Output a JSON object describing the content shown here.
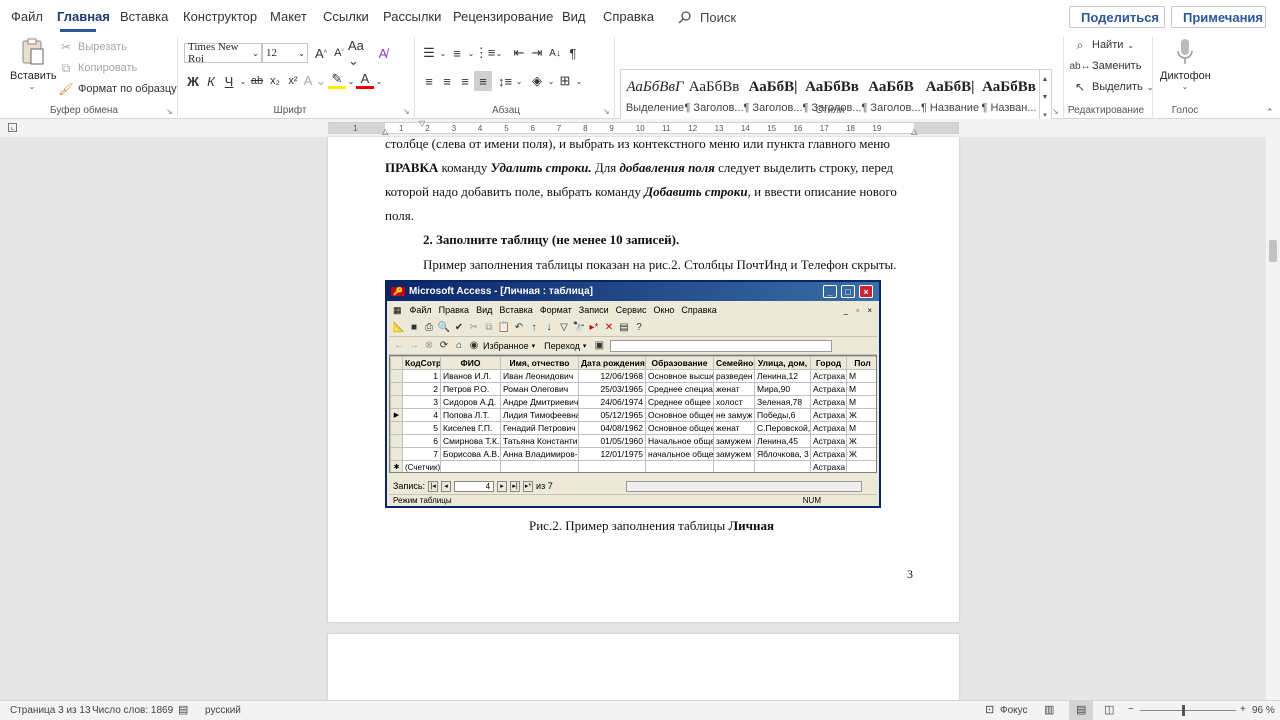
{
  "tabs": [
    "Файл",
    "Главная",
    "Вставка",
    "Конструктор",
    "Макет",
    "Ссылки",
    "Рассылки",
    "Рецензирование",
    "Вид",
    "Справка"
  ],
  "search_label": "Поиск",
  "share_label": "Поделиться",
  "notes_label": "Примечания",
  "clipboard": {
    "paste": "Вставить",
    "cut": "Вырезать",
    "copy": "Копировать",
    "format": "Формат по образцу",
    "group": "Буфер обмена"
  },
  "font": {
    "name": "Times New Roi",
    "size": "12",
    "group": "Шрифт"
  },
  "paragraph_group": "Абзац",
  "styles": {
    "group": "Стили",
    "items": [
      {
        "preview": "АаБбВвГ",
        "name": "Выделение"
      },
      {
        "preview": "АаБбВв",
        "name": "¶ Заголов..."
      },
      {
        "preview": "АаБбВ|",
        "name": "¶ Заголов..."
      },
      {
        "preview": "АаБбВв",
        "name": "¶ Заголов..."
      },
      {
        "preview": "АаБбВ",
        "name": "¶ Заголов..."
      },
      {
        "preview": "АаБбВ|",
        "name": "¶ Название"
      },
      {
        "preview": "АаБбВв",
        "name": "¶ Назван..."
      }
    ]
  },
  "editing": {
    "find": "Найти",
    "replace": "Заменить",
    "select": "Выделить",
    "group": "Редактирование"
  },
  "voice": {
    "dictate": "Диктофон",
    "group": "Голос"
  },
  "ruler_ticks": [
    "1",
    "1",
    "2",
    "3",
    "4",
    "5",
    "6",
    "7",
    "8",
    "9",
    "10",
    "11",
    "12",
    "13",
    "14",
    "15",
    "16",
    "17",
    "18",
    "19"
  ],
  "doc": {
    "line1": "столбце (слева от имени поля), и выбрать из контекстного меню или пункта главного меню",
    "line2a": "ПРАВКА",
    "line2b": " команду ",
    "line2c": "Удалить строки.",
    "line2d": " Для ",
    "line2e": "добавления поля",
    "line2f": " следует выделить строку, перед",
    "line3a": "которой надо добавить поле, выбрать команду ",
    "line3b": "Добавить строки",
    "line3c": ", и ввести описание нового",
    "line4": "поля.",
    "step2": "2. Заполните таблицу (не менее 10 записей).",
    "example": "Пример заполнения таблицы показан на рис.2. Столбцы ПочтИнд и Телефон скрыты.",
    "caption_a": "Рис.2. Пример заполнения таблицы ",
    "caption_b": "Личная",
    "page_num": "3"
  },
  "access": {
    "title": "Microsoft Access - [Личная : таблица]",
    "menu": [
      "Файл",
      "Правка",
      "Вид",
      "Вставка",
      "Формат",
      "Записи",
      "Сервис",
      "Окно",
      "Справка"
    ],
    "izbrannoe": "Избранное",
    "perehod": "Переход",
    "headers": [
      "КодСотр",
      "ФИО",
      "Имя, отчество",
      "Дата рождения",
      "Образование",
      "Семейное",
      "Улица, дом,",
      "Город",
      "Пол"
    ],
    "rows": [
      [
        "1",
        "Иванов И.Л.",
        "Иван Леонидович",
        "12/06/1968",
        "Основное высше",
        "разведен",
        "Ленина,12",
        "Астраха",
        "М"
      ],
      [
        "2",
        "Петров Р.О.",
        "Роман Олегович",
        "25/03/1965",
        "Среднее специал",
        "женат",
        "Мира,90",
        "Астраха",
        "М"
      ],
      [
        "3",
        "Сидоров А.Д.",
        "Андре Дмитриевич",
        "24/06/1974",
        "Среднее общее",
        "холост",
        "Зеленая,78",
        "Астраха",
        "М"
      ],
      [
        "4",
        "Попова Л.Т.",
        "Лидия Тимофеевна",
        "05/12/1965",
        "Основное общее",
        "не замуж",
        "Победы,6",
        "Астраха",
        "Ж"
      ],
      [
        "5",
        "Киселев Г.П.",
        "Генадий Петрович",
        "04/08/1962",
        "Основное общее",
        "женат",
        "С.Перовской,",
        "Астраха",
        "М"
      ],
      [
        "6",
        "Смирнова Т.К.",
        "Татьяна Константин",
        "01/05/1960",
        "Начальное обще",
        "замужем",
        "Ленина,45",
        "Астраха",
        "Ж"
      ],
      [
        "7",
        "Борисова А.В.",
        "Анна Владимиров-",
        "12/01/1975",
        "начальное обще",
        "замужем",
        "Яблочкова, 3",
        "Астраха",
        "Ж"
      ]
    ],
    "counter_label": "(Счетчик)",
    "counter_city": "Астраха",
    "nav_label": "Запись:",
    "nav_value": "4",
    "nav_total": "из 7",
    "status": "Режим таблицы",
    "num": "NUM"
  },
  "statusbar": {
    "page": "Страница 3 из 13",
    "words": "Число слов: 1869",
    "lang": "русский",
    "focus": "Фокус",
    "zoom": "96 %"
  }
}
